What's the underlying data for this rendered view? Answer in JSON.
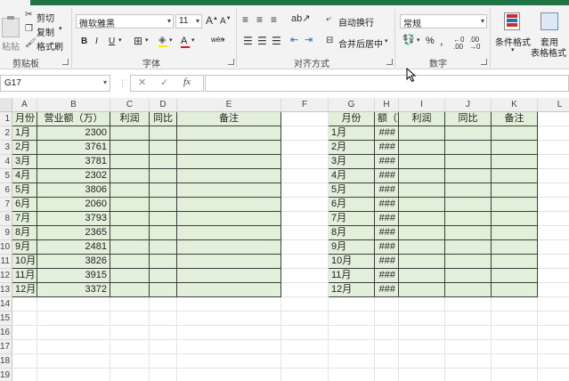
{
  "ribbon": {
    "clipboard": {
      "paste_label": "粘贴",
      "cut_label": "剪切",
      "copy_label": "复制",
      "format_painter_label": "格式刷",
      "group_label": "剪贴板"
    },
    "font": {
      "font_name": "微软雅黑",
      "font_size": "11",
      "bold": "B",
      "italic": "I",
      "underline": "U",
      "font_color_glyph": "A",
      "pinyin_glyph": "wén",
      "group_label": "字体"
    },
    "alignment": {
      "wrap_text_label": "自动换行",
      "merge_center_label": "合并后居中",
      "group_label": "对齐方式"
    },
    "number": {
      "format_value": "常规",
      "percent": "%",
      "comma": ",",
      "group_label": "数字"
    },
    "styles": {
      "conditional_format_label": "条件格式",
      "table_format_line1": "套用",
      "table_format_line2": "表格格式"
    }
  },
  "formula_bar": {
    "name_box": "G17",
    "cancel": "✕",
    "enter": "✓",
    "fx": "fx",
    "value": ""
  },
  "columns": [
    "A",
    "B",
    "C",
    "D",
    "E",
    "F",
    "G",
    "H",
    "I",
    "J",
    "K",
    "L"
  ],
  "rows": [
    "1",
    "2",
    "3",
    "4",
    "5",
    "6",
    "7",
    "8",
    "9",
    "10",
    "11",
    "12",
    "13",
    "14",
    "15",
    "16",
    "17",
    "18",
    "19"
  ],
  "table_left": {
    "headers": [
      "月份",
      "营业额（万）",
      "利润",
      "同比",
      "备注"
    ],
    "months": [
      "1月",
      "2月",
      "3月",
      "4月",
      "5月",
      "6月",
      "7月",
      "8月",
      "9月",
      "10月",
      "11月",
      "12月"
    ],
    "revenue": [
      "2300",
      "3761",
      "3781",
      "2302",
      "3806",
      "2060",
      "3793",
      "2365",
      "2481",
      "3826",
      "3915",
      "3372"
    ]
  },
  "table_right": {
    "headers": [
      "月份",
      "额（万",
      "利润",
      "同比",
      "备注"
    ],
    "months": [
      "1月",
      "2月",
      "3月",
      "4月",
      "5月",
      "6月",
      "7月",
      "8月",
      "9月",
      "10月",
      "11月",
      "12月"
    ],
    "overflow": [
      "###",
      "###",
      "###",
      "###",
      "###",
      "###",
      "###",
      "###",
      "###",
      "###",
      "###",
      "###"
    ]
  },
  "colors": {
    "accent": "#217346",
    "table_fill": "#e2efda"
  }
}
